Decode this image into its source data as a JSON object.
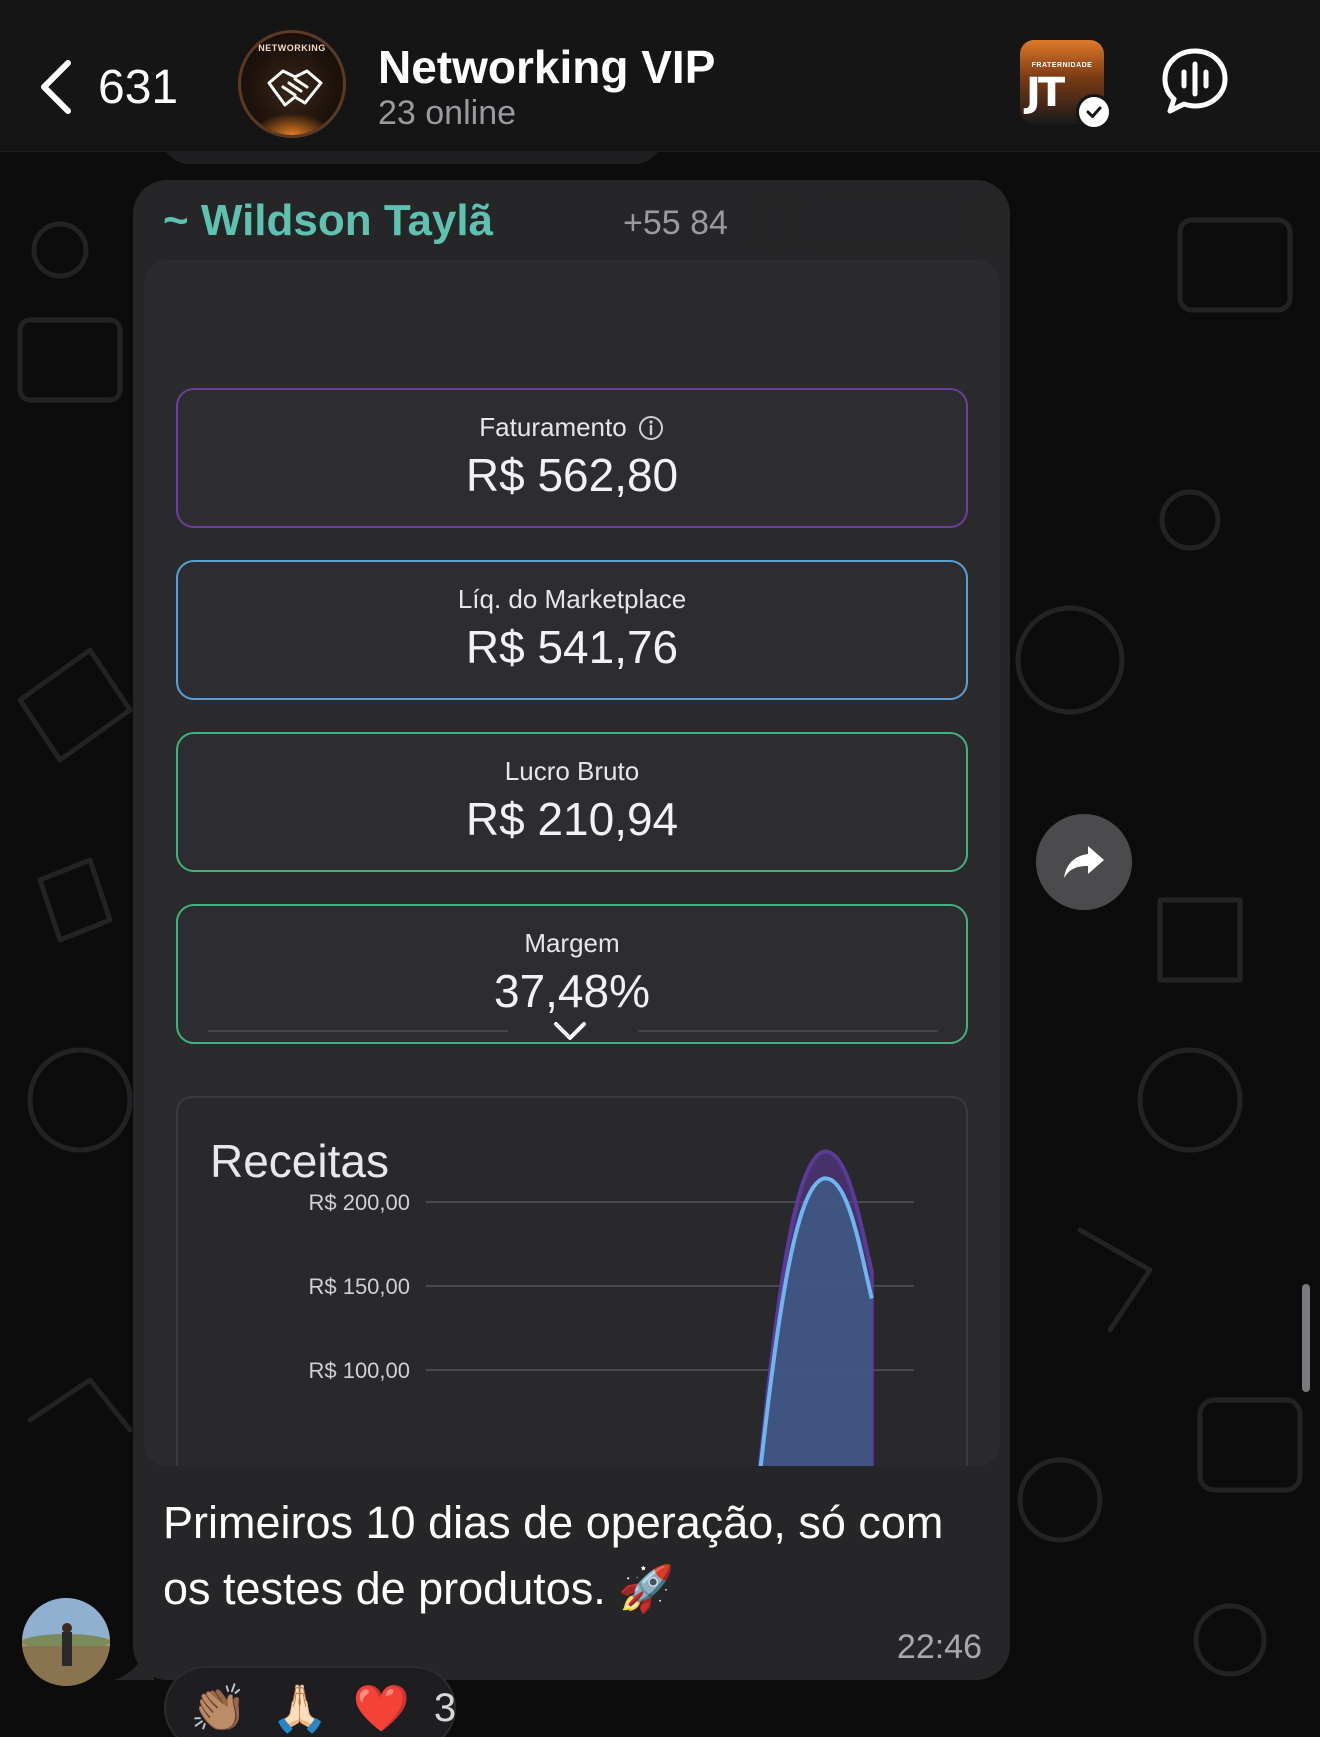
{
  "header": {
    "back_count": "631",
    "avatar_label": "NETWORKING",
    "title": "Networking VIP",
    "subtitle": "23 online",
    "channel_badge_text": "FRATERNIDADE",
    "channel_badge_logo": "JT"
  },
  "message": {
    "sender": "~ Wildson Taylã",
    "sender_phone": "+55 84",
    "caption": "Primeiros 10 dias de operação, só com os testes de produtos. 🚀",
    "time": "22:46"
  },
  "screenshot": {
    "metrics": [
      {
        "label": "Faturamento",
        "value": "R$ 562,80",
        "border": "#6a3fa0"
      },
      {
        "label": "Líq. do Marketplace",
        "value": "R$ 541,76",
        "border": "#5aa0d8"
      },
      {
        "label": "Lucro Bruto",
        "value": "R$ 210,94",
        "border": "#3fb27f"
      },
      {
        "label": "Margem",
        "value": "37,48%",
        "border": "#3fb27f"
      }
    ],
    "chart_title": "Receitas"
  },
  "chart_data": {
    "type": "area",
    "title": "Receitas",
    "yticks": [
      "R$ 200,00",
      "R$ 150,00",
      "R$ 100,00"
    ],
    "series": [
      {
        "values": [
          0,
          0,
          0,
          0,
          0,
          0,
          0,
          0,
          230,
          0
        ]
      },
      {
        "values": [
          0,
          0,
          0,
          0,
          0,
          0,
          0,
          0,
          214,
          0
        ]
      }
    ],
    "colors": {
      "series1": "#5b3a9a",
      "series2": "#6fb6ee"
    }
  },
  "reactions": {
    "emojis": [
      "👏🏽",
      "🙏🏻",
      "❤️"
    ],
    "count": "3"
  },
  "colors": {
    "sender": "#5ec2b1",
    "bubble": "#262628",
    "header": "#151516"
  }
}
